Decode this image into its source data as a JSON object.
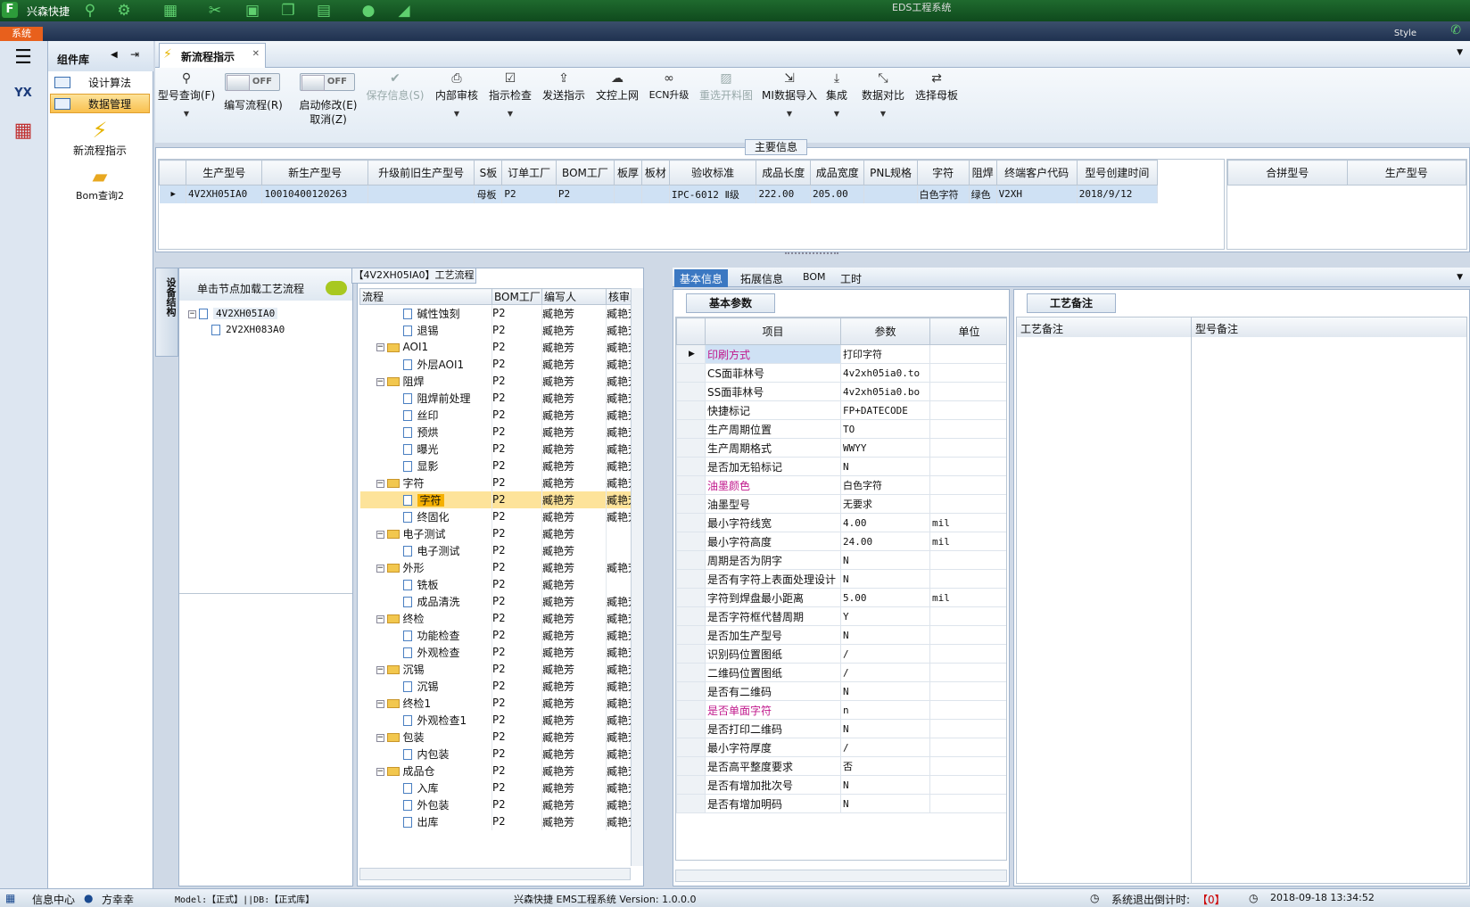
{
  "titlebar": {
    "app_name": "兴森快捷",
    "window_title": "EDS工程系统"
  },
  "menubar": {
    "system_tab": "系统",
    "style_label": "Style"
  },
  "complib": {
    "title": "组件库",
    "items": [
      {
        "label": "设计算法"
      },
      {
        "label": "数据管理"
      }
    ],
    "big_items": [
      {
        "label": "新流程指示"
      },
      {
        "label": "Bom查询2"
      }
    ]
  },
  "tab": {
    "title": "新流程指示"
  },
  "toolbar": {
    "query": "型号查询(F)",
    "write_flow": "编写流程(R)",
    "start_modify": "启动修改(E)",
    "cancel": "取消(Z)",
    "toggle_off": "OFF",
    "save": "保存信息(S)",
    "internal_review": "内部审核",
    "instruction_check": "指示检查",
    "send_instruction": "发送指示",
    "upload_doc": "文控上网",
    "ecn": "ECN升级",
    "redo_drawing": "重选开料图",
    "mi_import": "MI数据导入",
    "integrate": "集成",
    "compare": "数据对比",
    "select_board": "选择母板"
  },
  "maininfo": {
    "legend": "主要信息",
    "columns": [
      "生产型号",
      "新生产型号",
      "升级前旧生产型号",
      "S板",
      "订单工厂",
      "BOM工厂",
      "板厚",
      "板材",
      "验收标准",
      "成品长度",
      "成品宽度",
      "PNL规格",
      "字符",
      "阻焊",
      "终端客户代码",
      "型号创建时间"
    ],
    "row": [
      "4V2XH05IA0",
      "10010400120263",
      "",
      "母板",
      "P2",
      "P2",
      "",
      "",
      "IPC-6012 Ⅱ级",
      "222.00",
      "205.00",
      "",
      "白色字符",
      "绿色",
      "V2XH",
      "2018/9/12"
    ],
    "side_columns": [
      "合拼型号",
      "生产型号"
    ]
  },
  "device_structure": {
    "tab_label": "设备结构",
    "hint": "单击节点加载工艺流程",
    "nodes": [
      {
        "label": "4V2XH05IA0"
      },
      {
        "label": "2V2XH083A0"
      }
    ]
  },
  "process": {
    "title": "【4V2XH05IA0】工艺流程",
    "columns": [
      "流程",
      "BOM工厂",
      "编写人",
      "核审人"
    ],
    "rows": [
      {
        "name": "碱性蚀刻",
        "level": 1,
        "bom": "P2",
        "writer": "臧艳芳",
        "reviewer": "臧艳芳"
      },
      {
        "name": "退锡",
        "level": 1,
        "bom": "P2",
        "writer": "臧艳芳",
        "reviewer": "臧艳芳"
      },
      {
        "name": "AOI1",
        "level": 0,
        "bom": "P2",
        "writer": "臧艳芳",
        "reviewer": "臧艳芳"
      },
      {
        "name": "外层AOI1",
        "level": 1,
        "bom": "P2",
        "writer": "臧艳芳",
        "reviewer": "臧艳芳"
      },
      {
        "name": "阻焊",
        "level": 0,
        "bom": "P2",
        "writer": "臧艳芳",
        "reviewer": "臧艳芳"
      },
      {
        "name": "阻焊前处理",
        "level": 1,
        "bom": "P2",
        "writer": "臧艳芳",
        "reviewer": "臧艳芳"
      },
      {
        "name": "丝印",
        "level": 1,
        "bom": "P2",
        "writer": "臧艳芳",
        "reviewer": "臧艳芳"
      },
      {
        "name": "预烘",
        "level": 1,
        "bom": "P2",
        "writer": "臧艳芳",
        "reviewer": "臧艳芳"
      },
      {
        "name": "曝光",
        "level": 1,
        "bom": "P2",
        "writer": "臧艳芳",
        "reviewer": "臧艳芳"
      },
      {
        "name": "显影",
        "level": 1,
        "bom": "P2",
        "writer": "臧艳芳",
        "reviewer": "臧艳芳"
      },
      {
        "name": "字符",
        "level": 0,
        "bom": "P2",
        "writer": "臧艳芳",
        "reviewer": "臧艳芳"
      },
      {
        "name": "字符",
        "level": 1,
        "bom": "P2",
        "writer": "臧艳芳",
        "reviewer": "臧艳芳",
        "selected": true
      },
      {
        "name": "终固化",
        "level": 1,
        "bom": "P2",
        "writer": "臧艳芳",
        "reviewer": "臧艳芳"
      },
      {
        "name": "电子测试",
        "level": 0,
        "bom": "P2",
        "writer": "臧艳芳",
        "reviewer": ""
      },
      {
        "name": "电子测试",
        "level": 1,
        "bom": "P2",
        "writer": "臧艳芳",
        "reviewer": ""
      },
      {
        "name": "外形",
        "level": 0,
        "bom": "P2",
        "writer": "臧艳芳",
        "reviewer": "臧艳芳"
      },
      {
        "name": "铣板",
        "level": 1,
        "bom": "P2",
        "writer": "臧艳芳",
        "reviewer": ""
      },
      {
        "name": "成品清洗",
        "level": 1,
        "bom": "P2",
        "writer": "臧艳芳",
        "reviewer": "臧艳芳"
      },
      {
        "name": "终检",
        "level": 0,
        "bom": "P2",
        "writer": "臧艳芳",
        "reviewer": "臧艳芳"
      },
      {
        "name": "功能检查",
        "level": 1,
        "bom": "P2",
        "writer": "臧艳芳",
        "reviewer": "臧艳芳"
      },
      {
        "name": "外观检查",
        "level": 1,
        "bom": "P2",
        "writer": "臧艳芳",
        "reviewer": "臧艳芳"
      },
      {
        "name": "沉锡",
        "level": 0,
        "bom": "P2",
        "writer": "臧艳芳",
        "reviewer": "臧艳芳"
      },
      {
        "name": "沉锡",
        "level": 1,
        "bom": "P2",
        "writer": "臧艳芳",
        "reviewer": "臧艳芳"
      },
      {
        "name": "终检1",
        "level": 0,
        "bom": "P2",
        "writer": "臧艳芳",
        "reviewer": "臧艳芳"
      },
      {
        "name": "外观检查1",
        "level": 1,
        "bom": "P2",
        "writer": "臧艳芳",
        "reviewer": "臧艳芳"
      },
      {
        "name": "包装",
        "level": 0,
        "bom": "P2",
        "writer": "臧艳芳",
        "reviewer": "臧艳芳"
      },
      {
        "name": "内包装",
        "level": 1,
        "bom": "P2",
        "writer": "臧艳芳",
        "reviewer": "臧艳芳"
      },
      {
        "name": "成品仓",
        "level": 0,
        "bom": "P2",
        "writer": "臧艳芳",
        "reviewer": "臧艳芳"
      },
      {
        "name": "入库",
        "level": 1,
        "bom": "P2",
        "writer": "臧艳芳",
        "reviewer": "臧艳芳"
      },
      {
        "name": "外包装",
        "level": 1,
        "bom": "P2",
        "writer": "臧艳芳",
        "reviewer": "臧艳芳"
      },
      {
        "name": "出库",
        "level": 1,
        "bom": "P2",
        "writer": "臧艳芳",
        "reviewer": "臧艳芳"
      }
    ]
  },
  "info_tabs": [
    "基本信息",
    "拓展信息",
    "BOM",
    "工时"
  ],
  "basic_params": {
    "tab": "基本参数",
    "columns": [
      "项目",
      "参数",
      "单位"
    ],
    "rows": [
      {
        "item": "印刷方式",
        "value": "打印字符",
        "unit": "",
        "pink": true
      },
      {
        "item": "CS面菲林号",
        "value": "4v2xh05ia0.to",
        "unit": ""
      },
      {
        "item": "SS面菲林号",
        "value": "4v2xh05ia0.bo",
        "unit": ""
      },
      {
        "item": "快捷标记",
        "value": "FP+DATECODE",
        "unit": ""
      },
      {
        "item": "生产周期位置",
        "value": "TO",
        "unit": ""
      },
      {
        "item": "生产周期格式",
        "value": "WWYY",
        "unit": ""
      },
      {
        "item": "是否加无铅标记",
        "value": "N",
        "unit": ""
      },
      {
        "item": "油墨颜色",
        "value": "白色字符",
        "unit": "",
        "pink": true
      },
      {
        "item": "油墨型号",
        "value": "无要求",
        "unit": ""
      },
      {
        "item": "最小字符线宽",
        "value": "4.00",
        "unit": "mil"
      },
      {
        "item": "最小字符高度",
        "value": "24.00",
        "unit": "mil"
      },
      {
        "item": "周期是否为阴字",
        "value": "N",
        "unit": ""
      },
      {
        "item": "是否有字符上表面处理设计",
        "value": "N",
        "unit": ""
      },
      {
        "item": "字符到焊盘最小距离",
        "value": "5.00",
        "unit": "mil"
      },
      {
        "item": "是否字符框代替周期",
        "value": "Y",
        "unit": ""
      },
      {
        "item": "是否加生产型号",
        "value": "N",
        "unit": ""
      },
      {
        "item": "识别码位置图纸",
        "value": "/",
        "unit": ""
      },
      {
        "item": "二维码位置图纸",
        "value": "/",
        "unit": ""
      },
      {
        "item": "是否有二维码",
        "value": "N",
        "unit": ""
      },
      {
        "item": "是否单面字符",
        "value": "n",
        "unit": "",
        "pink": true
      },
      {
        "item": "是否打印二维码",
        "value": "N",
        "unit": ""
      },
      {
        "item": "最小字符厚度",
        "value": "/",
        "unit": ""
      },
      {
        "item": "是否高平整度要求",
        "value": "否",
        "unit": ""
      },
      {
        "item": "是否有增加批次号",
        "value": "N",
        "unit": ""
      },
      {
        "item": "是否有增加明码",
        "value": "N",
        "unit": ""
      }
    ]
  },
  "process_notes": {
    "tab": "工艺备注",
    "columns": [
      "工艺备注",
      "型号备注"
    ]
  },
  "statusbar": {
    "info_center": "信息中心",
    "user": "方幸幸",
    "model_db": "Model:【正式】||DB:【正式库】",
    "version": "兴森快捷 EMS工程系统 Version: 1.0.0.0",
    "countdown_label": "系统退出倒计时:",
    "countdown_value": "【0】",
    "datetime": "2018-09-18 13:34:52"
  }
}
